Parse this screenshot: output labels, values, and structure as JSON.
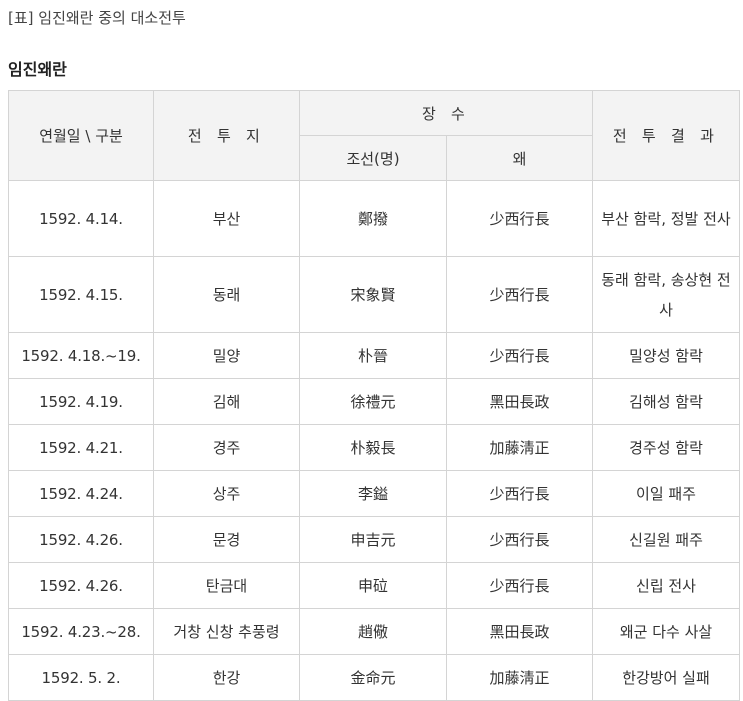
{
  "caption": "[표] 임진왜란 중의 대소전투",
  "section_title": "임진왜란",
  "table": {
    "headers": {
      "date": "연월일 \\ 구분",
      "place": "전 투 지",
      "commanders": "장 수",
      "joseon": "조선(명)",
      "japan": "왜",
      "result": "전 투 결 과"
    },
    "rows": [
      {
        "date": "1592. 4.14.",
        "place": "부산",
        "joseon": "鄭撥",
        "japan": "少西行長",
        "result": "부산 함락, 정발 전사"
      },
      {
        "date": "1592. 4.15.",
        "place": "동래",
        "joseon": "宋象賢",
        "japan": "少西行長",
        "result": "동래 함락, 송상현 전사"
      },
      {
        "date": "1592. 4.18.~19.",
        "place": "밀양",
        "joseon": "朴晉",
        "japan": "少西行長",
        "result": "밀양성 함락"
      },
      {
        "date": "1592. 4.19.",
        "place": "김해",
        "joseon": "徐禮元",
        "japan": "黑田長政",
        "result": "김해성 함락"
      },
      {
        "date": "1592. 4.21.",
        "place": "경주",
        "joseon": "朴毅長",
        "japan": "加藤淸正",
        "result": "경주성 함락"
      },
      {
        "date": "1592. 4.24.",
        "place": "상주",
        "joseon": "李鎰",
        "japan": "少西行長",
        "result": "이일 패주"
      },
      {
        "date": "1592. 4.26.",
        "place": "문경",
        "joseon": "申吉元",
        "japan": "少西行長",
        "result": "신길원 패주"
      },
      {
        "date": "1592. 4.26.",
        "place": "탄금대",
        "joseon": "申砬",
        "japan": "少西行長",
        "result": "신립 전사"
      },
      {
        "date": "1592. 4.23.~28.",
        "place": "거창 신창 추풍령",
        "joseon": "趙儆",
        "japan": "黑田長政",
        "result": "왜군 다수 사살"
      },
      {
        "date": "1592. 5. 2.",
        "place": "한강",
        "joseon": "金命元",
        "japan": "加藤淸正",
        "result": "한강방어 실패"
      }
    ]
  }
}
